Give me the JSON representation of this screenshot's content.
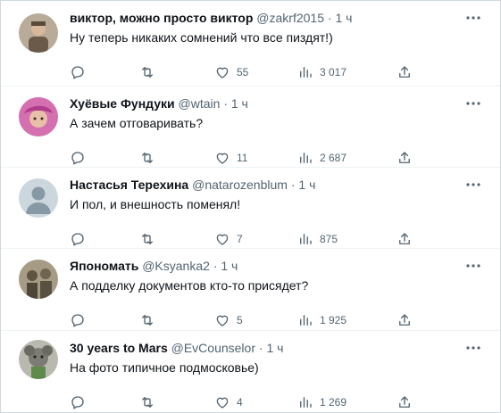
{
  "tweets": [
    {
      "name": "виктор, можно просто виктор",
      "handle": "@zakrf2015",
      "dot": "·",
      "time": "1 ч",
      "text": "Ну теперь никаких сомнений что все пиздят!)",
      "replies": "",
      "retweets": "",
      "likes": "55",
      "views": "3 017",
      "avatar_color": "#8a7a6a"
    },
    {
      "name": "Хуёвые Фундуки",
      "handle": "@wtain",
      "dot": "·",
      "time": "1 ч",
      "text": "А зачем отговаривать?",
      "replies": "",
      "retweets": "",
      "likes": "11",
      "views": "2 687",
      "avatar_color": "#c0569e"
    },
    {
      "name": "Настасья Терехина",
      "handle": "@natarozenblum",
      "dot": "·",
      "time": "1 ч",
      "text": "И пол, и внешность поменял!",
      "replies": "",
      "retweets": "",
      "likes": "7",
      "views": "875",
      "avatar_color": "#ccd6dd"
    },
    {
      "name": "Япономать",
      "handle": "@Ksyanka2",
      "dot": "·",
      "time": "1 ч",
      "text": "А подделку документов кто-то присядет?",
      "replies": "",
      "retweets": "",
      "likes": "5",
      "views": "1 925",
      "avatar_color": "#7d7360"
    },
    {
      "name": "30 years to Mars",
      "handle": "@EvCounselor",
      "dot": "·",
      "time": "1 ч",
      "text": "На фото типичное подмосковье)",
      "replies": "",
      "retweets": "",
      "likes": "4",
      "views": "1 269",
      "avatar_color": "#8f8f88"
    }
  ],
  "icons": {
    "reply": "reply-icon",
    "retweet": "retweet-icon",
    "like": "like-icon",
    "views": "views-icon",
    "share": "share-icon",
    "more": "more-icon"
  }
}
